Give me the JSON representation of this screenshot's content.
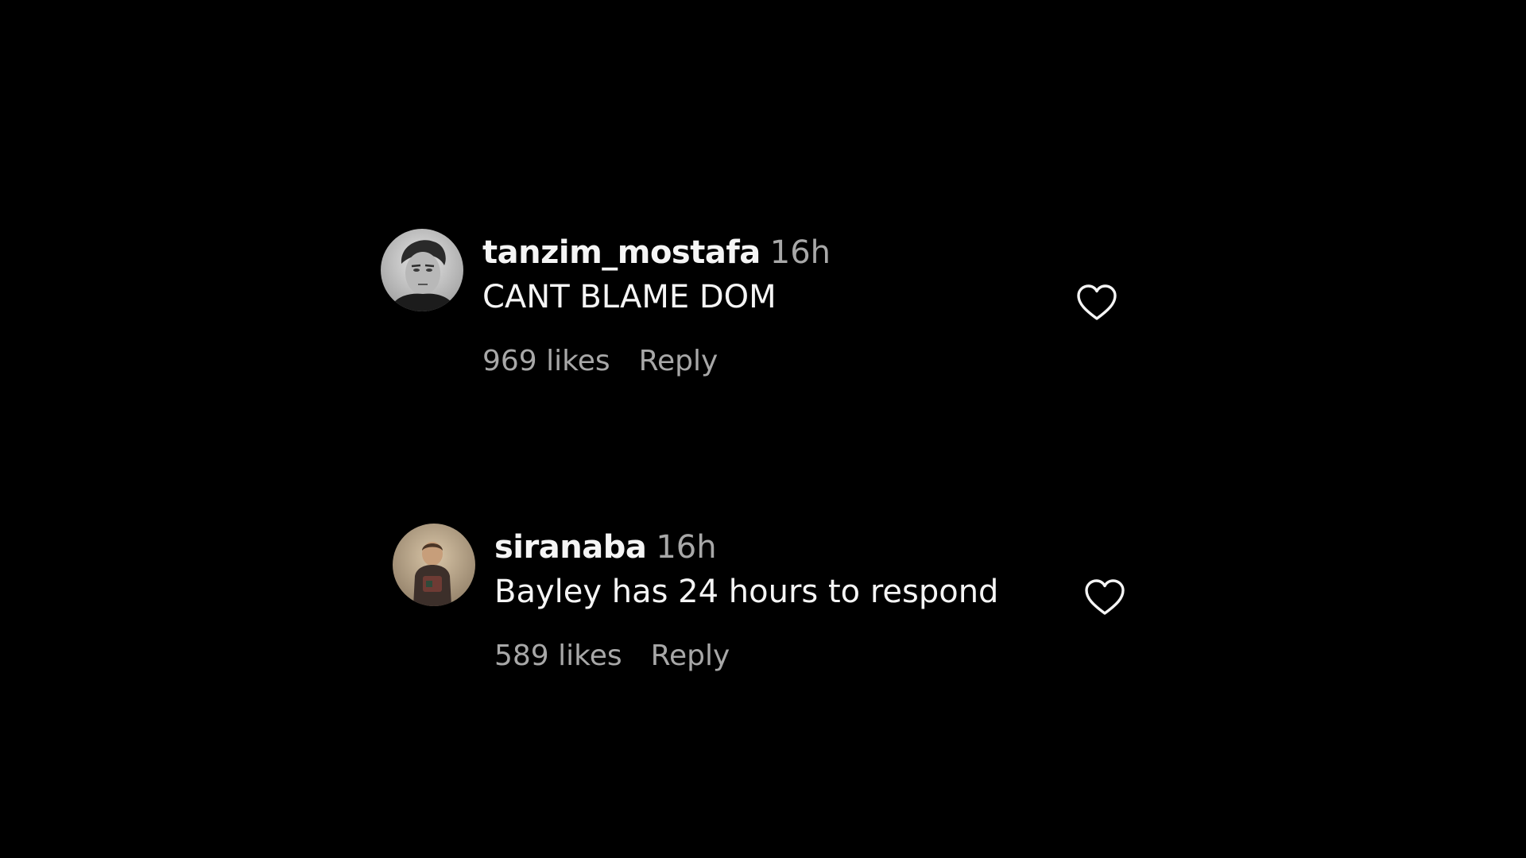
{
  "comments": [
    {
      "username": "tanzim_mostafa",
      "time": "16h",
      "text": "CANT BLAME DOM",
      "likes": "969 likes",
      "reply_label": "Reply",
      "avatar_icon": "profile-photo-icon",
      "like_icon": "heart-outline-icon"
    },
    {
      "username": "siranaba",
      "time": "16h",
      "text": "Bayley has 24 hours to respond",
      "likes": "589 likes",
      "reply_label": "Reply",
      "avatar_icon": "profile-photo-icon",
      "like_icon": "heart-outline-icon"
    }
  ],
  "colors": {
    "background": "#000000",
    "primary_text": "#f5f5f5",
    "secondary_text": "#a8a8a8"
  }
}
